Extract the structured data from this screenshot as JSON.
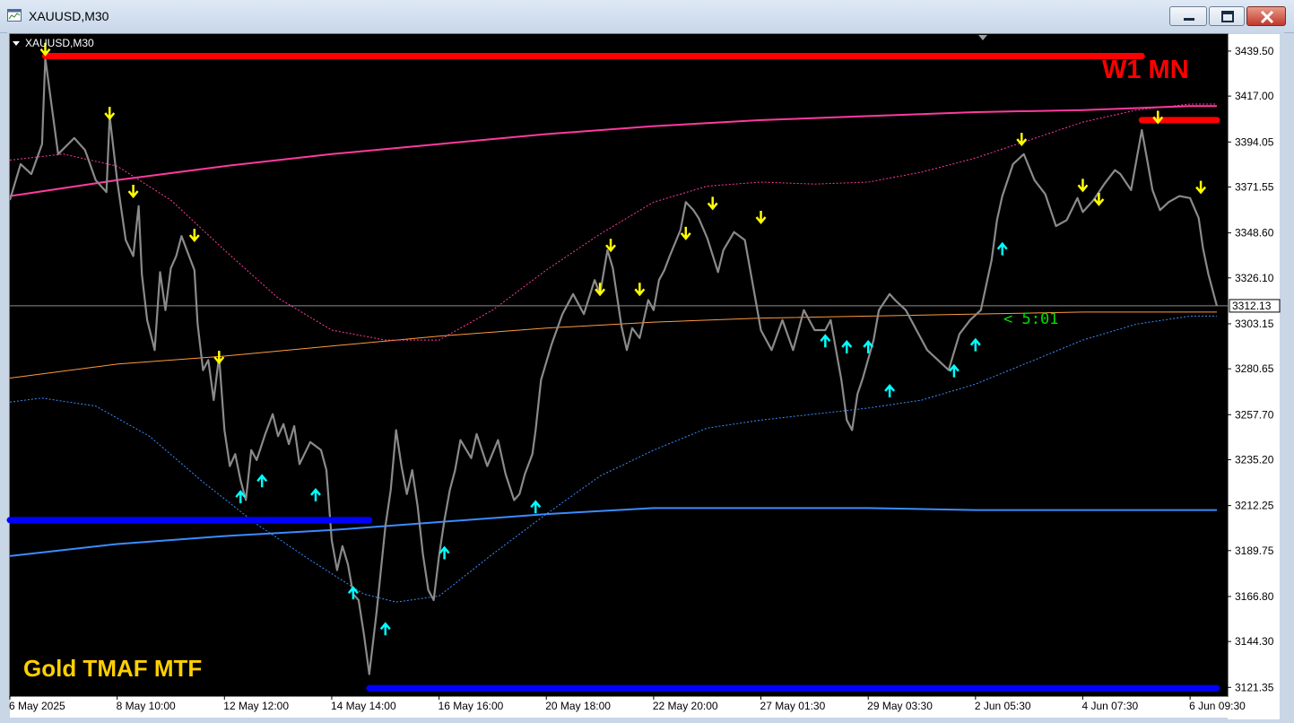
{
  "window": {
    "title": "XAUUSD,M30",
    "buttons": [
      "minimize",
      "restore",
      "close"
    ]
  },
  "chart_header": {
    "symbol_label": "XAUUSD,M30"
  },
  "overlays": {
    "timeframe_label": "W1 MN",
    "indicator_label": "Gold TMAF MTF",
    "bar_timer": "< 5:01",
    "current_price": "3312.13"
  },
  "colors": {
    "background": "#000000",
    "price_line": "#8a8a8a",
    "resistance_zone": "#ff0000",
    "support_zone": "#0000ff",
    "upper_band_htf": "#ff3aa0",
    "lower_band_htf": "#3a8cff",
    "upper_band_ltf": "#ff3aa0",
    "lower_band_ltf": "#3a8cff",
    "mid_line": "#ff9a40",
    "sell_arrow": "#ffff00",
    "buy_arrow": "#00ffff",
    "timer": "#00e000"
  },
  "chart_data": {
    "type": "line",
    "title": "XAUUSD,M30",
    "y_ticks": [
      "3439.50",
      "3417.00",
      "3394.05",
      "3371.55",
      "3348.60",
      "3326.10",
      "3303.15",
      "3280.65",
      "3257.70",
      "3235.20",
      "3212.25",
      "3189.75",
      "3166.80",
      "3144.30",
      "3121.35"
    ],
    "x_ticks": [
      "6 May 2025",
      "8 May 10:00",
      "12 May 12:00",
      "14 May 14:00",
      "16 May 16:00",
      "20 May 18:00",
      "22 May 20:00",
      "27 May 01:30",
      "29 May 03:30",
      "2 Jun 05:30",
      "4 Jun 07:30",
      "6 Jun 09:30"
    ],
    "ylim": [
      3117,
      3448
    ],
    "xlim": [
      0,
      11.35
    ],
    "price_path": [
      [
        0.0,
        3365
      ],
      [
        0.1,
        3383
      ],
      [
        0.2,
        3378
      ],
      [
        0.3,
        3393
      ],
      [
        0.33,
        3436
      ],
      [
        0.45,
        3388
      ],
      [
        0.6,
        3396
      ],
      [
        0.7,
        3390
      ],
      [
        0.8,
        3375
      ],
      [
        0.9,
        3369
      ],
      [
        0.93,
        3407
      ],
      [
        1.0,
        3375
      ],
      [
        1.08,
        3345
      ],
      [
        1.15,
        3337
      ],
      [
        1.2,
        3362
      ],
      [
        1.23,
        3328
      ],
      [
        1.28,
        3305
      ],
      [
        1.35,
        3290
      ],
      [
        1.4,
        3329
      ],
      [
        1.45,
        3310
      ],
      [
        1.5,
        3331
      ],
      [
        1.55,
        3337
      ],
      [
        1.6,
        3347
      ],
      [
        1.72,
        3330
      ],
      [
        1.75,
        3303
      ],
      [
        1.8,
        3280
      ],
      [
        1.85,
        3285
      ],
      [
        1.9,
        3265
      ],
      [
        1.95,
        3287
      ],
      [
        2.0,
        3250
      ],
      [
        2.05,
        3232
      ],
      [
        2.1,
        3238
      ],
      [
        2.15,
        3225
      ],
      [
        2.2,
        3215
      ],
      [
        2.25,
        3240
      ],
      [
        2.3,
        3235
      ],
      [
        2.38,
        3248
      ],
      [
        2.45,
        3258
      ],
      [
        2.5,
        3247
      ],
      [
        2.55,
        3253
      ],
      [
        2.6,
        3243
      ],
      [
        2.65,
        3252
      ],
      [
        2.7,
        3233
      ],
      [
        2.8,
        3244
      ],
      [
        2.9,
        3240
      ],
      [
        2.95,
        3230
      ],
      [
        3.0,
        3195
      ],
      [
        3.05,
        3180
      ],
      [
        3.1,
        3192
      ],
      [
        3.15,
        3183
      ],
      [
        3.2,
        3168
      ],
      [
        3.25,
        3165
      ],
      [
        3.3,
        3148
      ],
      [
        3.35,
        3128
      ],
      [
        3.42,
        3160
      ],
      [
        3.5,
        3202
      ],
      [
        3.55,
        3220
      ],
      [
        3.6,
        3250
      ],
      [
        3.65,
        3232
      ],
      [
        3.7,
        3218
      ],
      [
        3.75,
        3230
      ],
      [
        3.8,
        3212
      ],
      [
        3.85,
        3188
      ],
      [
        3.9,
        3170
      ],
      [
        3.95,
        3165
      ],
      [
        4.0,
        3187
      ],
      [
        4.05,
        3205
      ],
      [
        4.1,
        3220
      ],
      [
        4.15,
        3230
      ],
      [
        4.2,
        3245
      ],
      [
        4.3,
        3236
      ],
      [
        4.35,
        3248
      ],
      [
        4.45,
        3232
      ],
      [
        4.55,
        3245
      ],
      [
        4.62,
        3228
      ],
      [
        4.7,
        3215
      ],
      [
        4.75,
        3218
      ],
      [
        4.8,
        3228
      ],
      [
        4.87,
        3238
      ],
      [
        4.9,
        3250
      ],
      [
        4.95,
        3275
      ],
      [
        5.05,
        3293
      ],
      [
        5.15,
        3308
      ],
      [
        5.25,
        3318
      ],
      [
        5.35,
        3308
      ],
      [
        5.45,
        3325
      ],
      [
        5.5,
        3318
      ],
      [
        5.57,
        3340
      ],
      [
        5.62,
        3331
      ],
      [
        5.7,
        3302
      ],
      [
        5.75,
        3290
      ],
      [
        5.8,
        3301
      ],
      [
        5.87,
        3296
      ],
      [
        5.95,
        3315
      ],
      [
        6.0,
        3310
      ],
      [
        6.05,
        3325
      ],
      [
        6.1,
        3330
      ],
      [
        6.15,
        3337
      ],
      [
        6.25,
        3350
      ],
      [
        6.3,
        3364
      ],
      [
        6.37,
        3360
      ],
      [
        6.42,
        3356
      ],
      [
        6.5,
        3346
      ],
      [
        6.6,
        3329
      ],
      [
        6.65,
        3340
      ],
      [
        6.75,
        3349
      ],
      [
        6.85,
        3345
      ],
      [
        6.95,
        3315
      ],
      [
        7.0,
        3300
      ],
      [
        7.1,
        3290
      ],
      [
        7.2,
        3305
      ],
      [
        7.3,
        3290
      ],
      [
        7.4,
        3310
      ],
      [
        7.5,
        3300
      ],
      [
        7.6,
        3300
      ],
      [
        7.65,
        3305
      ],
      [
        7.7,
        3290
      ],
      [
        7.75,
        3275
      ],
      [
        7.8,
        3255
      ],
      [
        7.85,
        3250
      ],
      [
        7.9,
        3268
      ],
      [
        7.95,
        3276
      ],
      [
        8.05,
        3295
      ],
      [
        8.1,
        3310
      ],
      [
        8.2,
        3318
      ],
      [
        8.25,
        3315
      ],
      [
        8.35,
        3310
      ],
      [
        8.45,
        3300
      ],
      [
        8.55,
        3290
      ],
      [
        8.65,
        3285
      ],
      [
        8.75,
        3280
      ],
      [
        8.85,
        3298
      ],
      [
        8.95,
        3305
      ],
      [
        9.05,
        3310
      ],
      [
        9.15,
        3335
      ],
      [
        9.2,
        3355
      ],
      [
        9.25,
        3367
      ],
      [
        9.35,
        3383
      ],
      [
        9.45,
        3388
      ],
      [
        9.55,
        3375
      ],
      [
        9.65,
        3368
      ],
      [
        9.75,
        3352
      ],
      [
        9.85,
        3355
      ],
      [
        9.95,
        3366
      ],
      [
        10.0,
        3359
      ],
      [
        10.1,
        3365
      ],
      [
        10.2,
        3373
      ],
      [
        10.3,
        3380
      ],
      [
        10.35,
        3378
      ],
      [
        10.45,
        3370
      ],
      [
        10.55,
        3400
      ],
      [
        10.6,
        3385
      ],
      [
        10.65,
        3370
      ],
      [
        10.72,
        3360
      ],
      [
        10.8,
        3364
      ],
      [
        10.9,
        3367
      ],
      [
        11.0,
        3366
      ],
      [
        11.08,
        3356
      ],
      [
        11.12,
        3341
      ],
      [
        11.17,
        3328
      ],
      [
        11.25,
        3312
      ]
    ],
    "ma_slow_upper": [
      [
        0.0,
        3367
      ],
      [
        1.0,
        3375
      ],
      [
        2.0,
        3382
      ],
      [
        3.0,
        3388
      ],
      [
        4.0,
        3393
      ],
      [
        5.0,
        3398
      ],
      [
        6.0,
        3402
      ],
      [
        7.0,
        3405
      ],
      [
        8.0,
        3407
      ],
      [
        9.0,
        3409
      ],
      [
        10.0,
        3410
      ],
      [
        11.0,
        3412
      ],
      [
        11.25,
        3412
      ]
    ],
    "ma_slow_lower": [
      [
        0.0,
        3187
      ],
      [
        1.0,
        3193
      ],
      [
        2.0,
        3197
      ],
      [
        3.0,
        3200
      ],
      [
        4.0,
        3204
      ],
      [
        5.0,
        3208
      ],
      [
        6.0,
        3211
      ],
      [
        7.0,
        3211
      ],
      [
        8.0,
        3211
      ],
      [
        9.0,
        3210
      ],
      [
        10.0,
        3210
      ],
      [
        11.0,
        3210
      ],
      [
        11.25,
        3210
      ]
    ],
    "ma_mid": [
      [
        0.0,
        3276
      ],
      [
        1.0,
        3283
      ],
      [
        2.0,
        3287
      ],
      [
        3.0,
        3292
      ],
      [
        4.0,
        3297
      ],
      [
        5.0,
        3301
      ],
      [
        6.0,
        3304
      ],
      [
        7.0,
        3306
      ],
      [
        8.0,
        3307
      ],
      [
        9.0,
        3308
      ],
      [
        10.0,
        3309
      ],
      [
        11.0,
        3309
      ],
      [
        11.25,
        3309
      ]
    ],
    "band_fast_upper": [
      [
        0.0,
        3385
      ],
      [
        0.5,
        3388
      ],
      [
        1.0,
        3382
      ],
      [
        1.5,
        3365
      ],
      [
        2.0,
        3340
      ],
      [
        2.5,
        3316
      ],
      [
        3.0,
        3300
      ],
      [
        3.5,
        3295
      ],
      [
        4.0,
        3295
      ],
      [
        4.5,
        3310
      ],
      [
        5.0,
        3330
      ],
      [
        5.5,
        3348
      ],
      [
        6.0,
        3364
      ],
      [
        6.5,
        3372
      ],
      [
        7.0,
        3374
      ],
      [
        7.5,
        3373
      ],
      [
        8.0,
        3374
      ],
      [
        8.5,
        3379
      ],
      [
        9.0,
        3386
      ],
      [
        9.5,
        3395
      ],
      [
        10.0,
        3404
      ],
      [
        10.5,
        3410
      ],
      [
        11.0,
        3413
      ],
      [
        11.25,
        3413
      ]
    ],
    "band_fast_lower": [
      [
        0.0,
        3264
      ],
      [
        0.3,
        3266
      ],
      [
        0.8,
        3262
      ],
      [
        1.3,
        3247
      ],
      [
        1.8,
        3224
      ],
      [
        2.3,
        3203
      ],
      [
        2.8,
        3185
      ],
      [
        3.3,
        3168
      ],
      [
        3.6,
        3164
      ],
      [
        4.0,
        3167
      ],
      [
        4.5,
        3188
      ],
      [
        5.0,
        3208
      ],
      [
        5.5,
        3227
      ],
      [
        6.0,
        3240
      ],
      [
        6.5,
        3251
      ],
      [
        7.0,
        3255
      ],
      [
        7.5,
        3258
      ],
      [
        8.0,
        3261
      ],
      [
        8.5,
        3265
      ],
      [
        9.0,
        3273
      ],
      [
        9.5,
        3284
      ],
      [
        10.0,
        3295
      ],
      [
        10.5,
        3303
      ],
      [
        11.0,
        3307
      ],
      [
        11.25,
        3307
      ]
    ],
    "resistance_zones": [
      {
        "x0": 0.33,
        "x1": 10.55,
        "y": 3437
      },
      {
        "x0": 10.55,
        "x1": 11.25,
        "y": 3405
      }
    ],
    "support_zones": [
      {
        "x0": 0.0,
        "x1": 3.35,
        "y": 3205
      },
      {
        "x0": 3.35,
        "x1": 11.25,
        "y": 3121
      }
    ],
    "sell_arrows": [
      [
        0.33,
        3436
      ],
      [
        0.93,
        3404
      ],
      [
        1.15,
        3365
      ],
      [
        1.72,
        3343
      ],
      [
        1.95,
        3282
      ],
      [
        5.6,
        3338
      ],
      [
        5.87,
        3316
      ],
      [
        5.5,
        3316
      ],
      [
        6.3,
        3344
      ],
      [
        6.55,
        3359
      ],
      [
        7.0,
        3352
      ],
      [
        9.43,
        3391
      ],
      [
        10.0,
        3368
      ],
      [
        10.15,
        3361
      ],
      [
        10.7,
        3402
      ],
      [
        11.1,
        3367
      ]
    ],
    "buy_arrows": [
      [
        2.15,
        3221
      ],
      [
        2.35,
        3229
      ],
      [
        2.85,
        3222
      ],
      [
        3.2,
        3173
      ],
      [
        3.5,
        3155
      ],
      [
        4.05,
        3193
      ],
      [
        4.9,
        3216
      ],
      [
        7.6,
        3299
      ],
      [
        7.8,
        3296
      ],
      [
        8.0,
        3296
      ],
      [
        8.2,
        3274
      ],
      [
        8.8,
        3284
      ],
      [
        9.0,
        3297
      ],
      [
        9.25,
        3345
      ]
    ]
  }
}
